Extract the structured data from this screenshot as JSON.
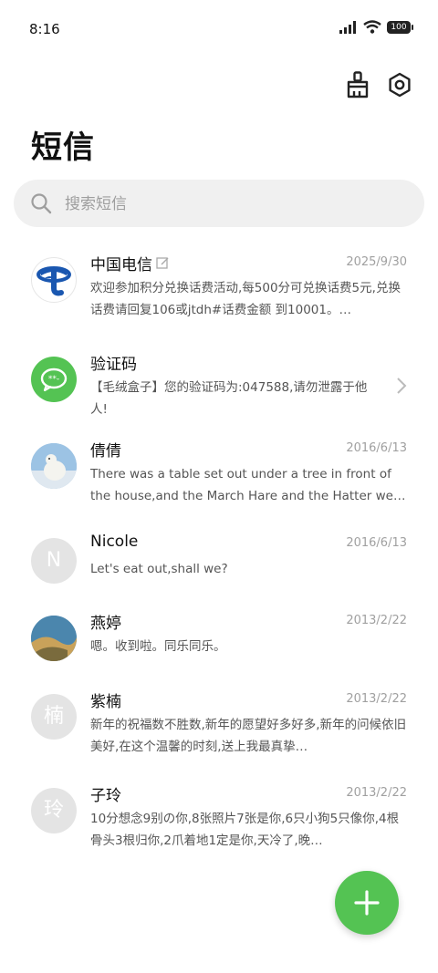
{
  "status": {
    "time": "8:16",
    "battery": "100"
  },
  "header": {
    "title": "短信"
  },
  "search": {
    "placeholder": "搜索短信"
  },
  "conversations": [
    {
      "name": "中国电信",
      "date": "2025/9/30",
      "snippet": "欢迎参加积分兑换话费活动,每500分可兑换话费5元,兑换话费请回复106或jtdh#话费金额 到10001。…",
      "avatar": "china-telecom-logo"
    },
    {
      "name": "验证码",
      "date": "",
      "snippet": "【毛绒盒子】您的验证码为:047588,请勿泄露于他人!",
      "avatar": "message-green"
    },
    {
      "name": "倩倩",
      "date": "2016/6/13",
      "snippet": "There was a table set out under a tree in front of the house,and the March Hare and the Hatter we…",
      "avatar": "polar-bear-photo"
    },
    {
      "name": "Nicole",
      "date": "2016/6/13",
      "snippet": "Let's eat out,shall we?",
      "avatar_text": "N"
    },
    {
      "name": "燕婷",
      "date": "2013/2/22",
      "snippet": "嗯。收到啦。同乐同乐。",
      "avatar": "landscape-photo"
    },
    {
      "name": "紫楠",
      "date": "2013/2/22",
      "snippet": "新年的祝福数不胜数,新年的愿望好多好多,新年的问候依旧美好,在这个温馨的时刻,送上我最真挚…",
      "avatar_text": "楠"
    },
    {
      "name": "子玲",
      "date": "2013/2/22",
      "snippet": "10分想念9别の你,8张照片7张是你,6只小狗5只像你,4根骨头3根归你,2爪着地1定是你,天冷了,晚…",
      "avatar_text": "玲"
    }
  ],
  "colors": {
    "accent": "#54c353",
    "telecom_blue": "#1a57b0",
    "date_gray": "#a0a0a0"
  }
}
